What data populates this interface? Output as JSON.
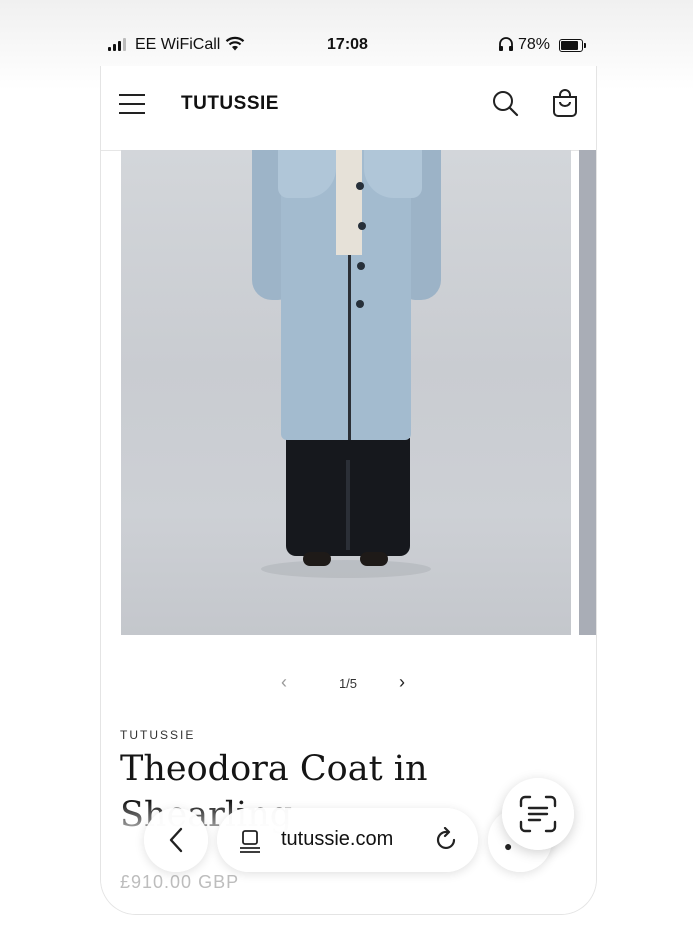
{
  "status_bar": {
    "carrier": "EE WiFiCall",
    "time": "17:08",
    "battery": "78%",
    "battery_level": 0.78,
    "icons": [
      "signal-icon",
      "wifi-icon",
      "headphones-icon",
      "battery-icon"
    ]
  },
  "header": {
    "logo": "TUTUSSIE",
    "icons": [
      "menu-icon",
      "search-icon",
      "cart-icon"
    ]
  },
  "gallery": {
    "counter": "1/5",
    "prev_symbol": "‹",
    "next_symbol": "›"
  },
  "product": {
    "vendor": "TUTUSSIE",
    "title": "Theodora Coat in Shearling",
    "price": "£910.00 GBP"
  },
  "browser_bar": {
    "url": "tutussie.com",
    "icons": [
      "back-icon",
      "tabs-icon",
      "reload-icon",
      "more-icon",
      "text-scan-icon"
    ]
  },
  "colors": {
    "accent": "#111111",
    "price": "#bdbdbd",
    "coat": "#a3bbcf"
  }
}
